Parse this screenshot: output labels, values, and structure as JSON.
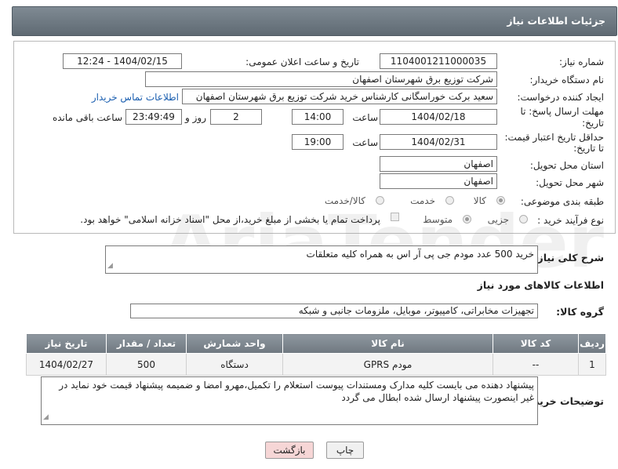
{
  "header": {
    "title": "جزئیات اطلاعات نیاز"
  },
  "form": {
    "need_number": {
      "label": "شماره نیاز:",
      "value": "1104001211000035"
    },
    "announce_datetime": {
      "label": "تاریخ و ساعت اعلان عمومی:",
      "value": "1404/02/15 - 12:24"
    },
    "buyer_org": {
      "label": "نام دستگاه خریدار:",
      "value": "شرکت توزیع برق شهرستان اصفهان"
    },
    "requester": {
      "label": "ایجاد کننده درخواست:",
      "value": "سعید برکت خوراسگانی کارشناس خرید شرکت توزیع برق شهرستان اصفهان",
      "link": "اطلاعات تماس خریدار"
    },
    "reply_deadline": {
      "label_line1": "مهلت ارسال پاسخ: تا",
      "label_line2": "تاریخ:",
      "date": "1404/02/18",
      "time_label": "ساعت",
      "time": "14:00",
      "days": "2",
      "days_label": "روز و",
      "remaining": "23:49:49",
      "remaining_label": "ساعت باقی مانده"
    },
    "price_validity": {
      "label_line1": "حداقل تاریخ اعتبار قیمت:",
      "label_line2": "تا تاریخ:",
      "date": "1404/02/31",
      "time_label": "ساعت",
      "time": "19:00"
    },
    "delivery_province": {
      "label": "استان محل تحویل:",
      "value": "اصفهان"
    },
    "delivery_city": {
      "label": "شهر محل تحویل:",
      "value": "اصفهان"
    },
    "category": {
      "label": "طبقه بندی موضوعی:",
      "options": [
        "کالا",
        "خدمت",
        "کالا/خدمت"
      ],
      "selected": "کالا"
    },
    "process_type": {
      "label": "نوع فرآیند خرید :",
      "options": [
        "جزیی",
        "متوسط"
      ],
      "selected": "متوسط",
      "payment_note": "پرداخت تمام یا بخشی از مبلغ خرید،از محل \"اسناد خزانه اسلامی\" خواهد بود."
    }
  },
  "description": {
    "label": "شرح کلی نیاز:",
    "value": "خرید 500 عدد مودم جی پی آر اس به همراه کلیه متعلقات"
  },
  "goods_info": {
    "title": "اطلاعات کالاهای مورد نیاز",
    "group_label": "گروه کالا:",
    "group_value": "تجهیزات مخابراتی، کامپیوتر، موبایل، ملزومات جانبی و شبکه"
  },
  "table": {
    "headers": [
      "ردیف",
      "کد کالا",
      "نام کالا",
      "واحد شمارش",
      "تعداد / مقدار",
      "تاریخ نیاز"
    ],
    "rows": [
      [
        "1",
        "--",
        "مودم GPRS",
        "دستگاه",
        "500",
        "1404/02/27"
      ]
    ]
  },
  "buyer_notes": {
    "label": "توضیحات خریدار:",
    "value": "پیشنهاد دهنده می بایست کلیه مدارک ومستندات پیوست استعلام را تکمیل،مهرو امضا و ضمیمه پیشنهاد قیمت خود نماید در غیر اینصورت پیشنهاد ارسال شده ابطال می گردد"
  },
  "buttons": {
    "print": "چاپ",
    "back": "بازگشت"
  },
  "colors": {
    "header_bg": "#6b767f",
    "link": "#1b5fb0",
    "back_button_bg": "#f6d6d6"
  }
}
